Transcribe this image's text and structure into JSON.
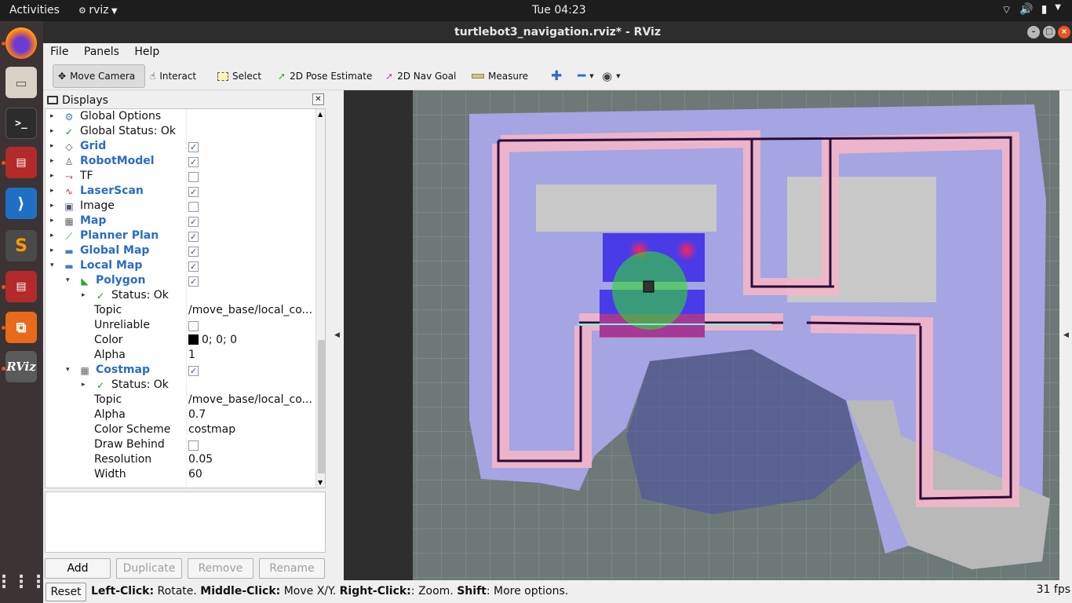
{
  "topbar": {
    "activities": "Activities",
    "app_name": "rviz",
    "clock": "Tue 04:23"
  },
  "dock": {
    "items": [
      "firefox-icon",
      "files-icon",
      "terminal-icon",
      "app-icon",
      "vscode-icon",
      "sublime-icon",
      "app-icon-2",
      "software-icon",
      "rviz-icon",
      "show-apps-icon"
    ],
    "rviz_label": "RViz"
  },
  "window": {
    "title": "turtlebot3_navigation.rviz* - RViz"
  },
  "menu": {
    "file": "File",
    "panels": "Panels",
    "help": "Help"
  },
  "toolbar": {
    "move_camera": "Move Camera",
    "interact": "Interact",
    "select": "Select",
    "pose_estimate": "2D Pose Estimate",
    "nav_goal": "2D Nav Goal",
    "measure": "Measure"
  },
  "displays_panel": {
    "title": "Displays",
    "rows": [
      {
        "label": "Global Options",
        "indent": 0,
        "arrow": "▸",
        "icon": "⚙",
        "icon_color": "#4a78b8",
        "bold": false,
        "check": null,
        "value": ""
      },
      {
        "label": "Global Status: Ok",
        "indent": 0,
        "arrow": "▸",
        "icon": "✓",
        "icon_color": "#2c8a2c",
        "bold": false,
        "check": null,
        "value": ""
      },
      {
        "label": "Grid",
        "indent": 0,
        "arrow": "▸",
        "icon": "◇",
        "icon_color": "#555",
        "bold": true,
        "check": true,
        "value": ""
      },
      {
        "label": "RobotModel",
        "indent": 0,
        "arrow": "▸",
        "icon": "♙",
        "icon_color": "#555",
        "bold": true,
        "check": true,
        "value": ""
      },
      {
        "label": "TF",
        "indent": 0,
        "arrow": "▸",
        "icon": "⤳",
        "icon_color": "#c03",
        "bold": false,
        "check": false,
        "value": ""
      },
      {
        "label": "LaserScan",
        "indent": 0,
        "arrow": "▸",
        "icon": "∿",
        "icon_color": "#d22",
        "bold": true,
        "check": true,
        "value": ""
      },
      {
        "label": "Image",
        "indent": 0,
        "arrow": "▸",
        "icon": "▣",
        "icon_color": "#557",
        "bold": false,
        "check": false,
        "value": ""
      },
      {
        "label": "Map",
        "indent": 0,
        "arrow": "▸",
        "icon": "▦",
        "icon_color": "#666",
        "bold": true,
        "check": true,
        "value": ""
      },
      {
        "label": "Planner Plan",
        "indent": 0,
        "arrow": "▸",
        "icon": "⟋",
        "icon_color": "#1a1",
        "bold": true,
        "check": true,
        "value": ""
      },
      {
        "label": "Global Map",
        "indent": 0,
        "arrow": "▸",
        "icon": "▬",
        "icon_color": "#4a7dc0",
        "bold": true,
        "check": true,
        "value": ""
      },
      {
        "label": "Local Map",
        "indent": 0,
        "arrow": "▾",
        "icon": "▬",
        "icon_color": "#4a7dc0",
        "bold": true,
        "check": true,
        "value": ""
      },
      {
        "label": "Polygon",
        "indent": 1,
        "arrow": "▾",
        "icon": "◣",
        "icon_color": "#2a2",
        "bold": true,
        "check": true,
        "value": ""
      },
      {
        "label": "Status: Ok",
        "indent": 2,
        "arrow": "▸",
        "icon": "✓",
        "icon_color": "#2c8a2c",
        "bold": false,
        "check": null,
        "value": ""
      },
      {
        "label": "Topic",
        "indent": 3,
        "arrow": "",
        "icon": "",
        "icon_color": "",
        "bold": false,
        "check": null,
        "value": "/move_base/local_co..."
      },
      {
        "label": "Unreliable",
        "indent": 3,
        "arrow": "",
        "icon": "",
        "icon_color": "",
        "bold": false,
        "check": false,
        "value": ""
      },
      {
        "label": "Color",
        "indent": 3,
        "arrow": "",
        "icon": "",
        "icon_color": "",
        "bold": false,
        "check": null,
        "value": "0; 0; 0",
        "swatch": "#000000"
      },
      {
        "label": "Alpha",
        "indent": 3,
        "arrow": "",
        "icon": "",
        "icon_color": "",
        "bold": false,
        "check": null,
        "value": "1"
      },
      {
        "label": "Costmap",
        "indent": 1,
        "arrow": "▾",
        "icon": "▦",
        "icon_color": "#666",
        "bold": true,
        "check": true,
        "value": ""
      },
      {
        "label": "Status: Ok",
        "indent": 2,
        "arrow": "▸",
        "icon": "✓",
        "icon_color": "#2c8a2c",
        "bold": false,
        "check": null,
        "value": ""
      },
      {
        "label": "Topic",
        "indent": 3,
        "arrow": "",
        "icon": "",
        "icon_color": "",
        "bold": false,
        "check": null,
        "value": "/move_base/local_co..."
      },
      {
        "label": "Alpha",
        "indent": 3,
        "arrow": "",
        "icon": "",
        "icon_color": "",
        "bold": false,
        "check": null,
        "value": "0.7"
      },
      {
        "label": "Color Scheme",
        "indent": 3,
        "arrow": "",
        "icon": "",
        "icon_color": "",
        "bold": false,
        "check": null,
        "value": "costmap"
      },
      {
        "label": "Draw Behind",
        "indent": 3,
        "arrow": "",
        "icon": "",
        "icon_color": "",
        "bold": false,
        "check": false,
        "value": ""
      },
      {
        "label": "Resolution",
        "indent": 3,
        "arrow": "",
        "icon": "",
        "icon_color": "",
        "bold": false,
        "check": null,
        "value": "0.05"
      },
      {
        "label": "Width",
        "indent": 3,
        "arrow": "",
        "icon": "",
        "icon_color": "",
        "bold": false,
        "check": null,
        "value": "60"
      }
    ],
    "buttons": {
      "add": "Add",
      "duplicate": "Duplicate",
      "remove": "Remove",
      "rename": "Rename"
    }
  },
  "statusbar": {
    "reset": "Reset",
    "left_click": "Left-Click:",
    "left_desc": " Rotate. ",
    "middle_click": "Middle-Click:",
    "middle_desc": " Move X/Y. ",
    "right_click": "Right-Click:",
    "right_desc": ": Zoom. ",
    "shift": "Shift",
    "shift_desc": ": More options.",
    "fps": "31 fps"
  },
  "colors": {
    "accent": "#e95420",
    "link_blue": "#2a6cc7",
    "map_bg": "#6b7a78"
  }
}
